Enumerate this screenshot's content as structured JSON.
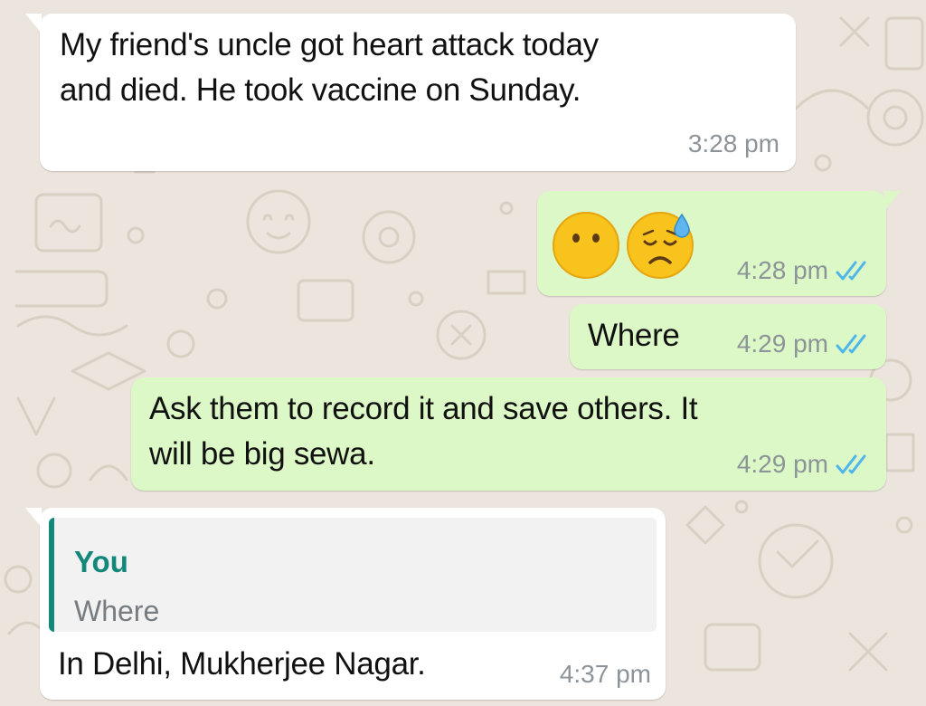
{
  "chat": {
    "messages": [
      {
        "direction": "incoming",
        "text_lines": [
          "My friend's uncle got heart attack today",
          "and died. He took vaccine on Sunday."
        ],
        "time": "3:28 pm"
      },
      {
        "direction": "outgoing",
        "emojis": [
          "face-without-mouth-emoji",
          "sad-but-relieved-emoji"
        ],
        "time": "4:28 pm",
        "status": "read"
      },
      {
        "direction": "outgoing",
        "text": "Where",
        "time": "4:29 pm",
        "status": "read"
      },
      {
        "direction": "outgoing",
        "text_lines": [
          "Ask them to record it and save others. It",
          "will be big sewa."
        ],
        "time": "4:29 pm",
        "status": "read"
      },
      {
        "direction": "incoming",
        "quote": {
          "author": "You",
          "text": "Where"
        },
        "text": "In Delhi, Mukherjee Nagar.",
        "time": "4:37 pm"
      }
    ]
  },
  "colors": {
    "background": "#ece5dd",
    "incoming_bubble": "#ffffff",
    "outgoing_bubble": "#dcf8c6",
    "read_ticks": "#4fb6ec",
    "quote_accent": "#13877a",
    "timestamp": "#8d9499"
  }
}
